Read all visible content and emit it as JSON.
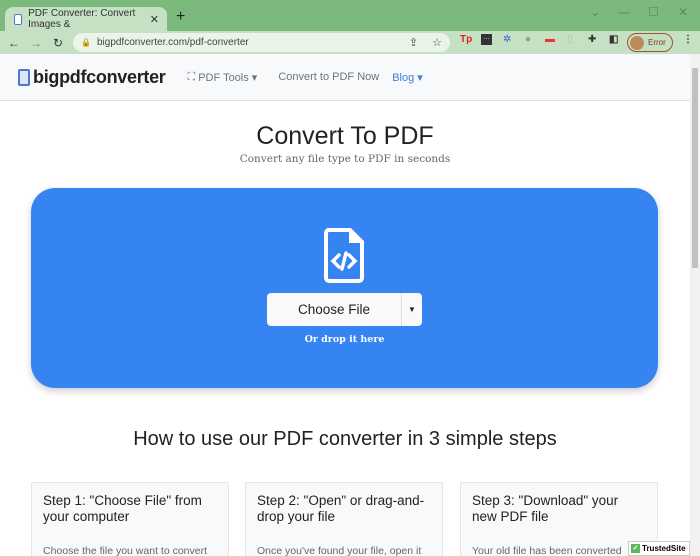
{
  "browser": {
    "tab_title": "PDF Converter: Convert Images &",
    "url": "bigpdfconverter.com/pdf-converter",
    "profile_label": "Error"
  },
  "nav": {
    "logo": "bigpdfconverter",
    "pdf_tools": "PDF Tools ▾",
    "convert_now": "Convert to PDF Now",
    "blog": "Blog ▾"
  },
  "hero": {
    "title": "Convert To PDF",
    "subtitle": "Convert any file type to PDF in seconds",
    "choose_file": "Choose File",
    "or_drop": "Or drop it here"
  },
  "steps": {
    "heading": "How to use our PDF converter in 3 simple steps",
    "items": [
      {
        "title": "Step 1: \"Choose File\" from your computer",
        "desc": "Choose the file you want to convert"
      },
      {
        "title": "Step 2: \"Open\" or drag-and-drop your file",
        "desc": "Once you've found your file, open it"
      },
      {
        "title": "Step 3: \"Download\" your new PDF file",
        "desc": "Your old file has been converted"
      }
    ]
  },
  "badge": {
    "label": "TrustedSite"
  },
  "colors": {
    "accent": "#3584f2",
    "chrome": "#7cb97c"
  }
}
